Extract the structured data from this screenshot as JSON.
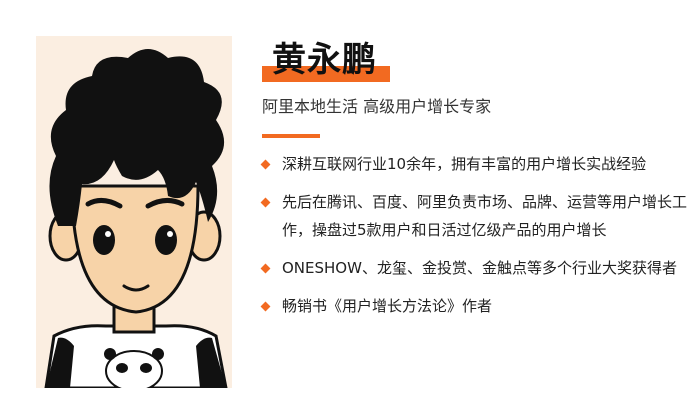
{
  "profile": {
    "name": "黄永鹏",
    "title": "阿里本地生活 高级用户增长专家",
    "bullets": [
      "深耕互联网行业10余年，拥有丰富的用户增长实战经验",
      "先后在腾讯、百度、阿里负责市场、品牌、运营等用户增长工作，操盘过5款用户和日活过亿级产品的用户增长",
      "ONESHOW、龙玺、金投赏、金触点等多个行业大奖获得者",
      "畅销书《用户增长方法论》作者"
    ]
  },
  "colors": {
    "accent": "#f26a21",
    "portrait_bg": "#fbeee1",
    "text_primary": "#111111",
    "text_secondary": "#333333"
  },
  "icons": {
    "bullet": "orange-diamond-icon"
  }
}
